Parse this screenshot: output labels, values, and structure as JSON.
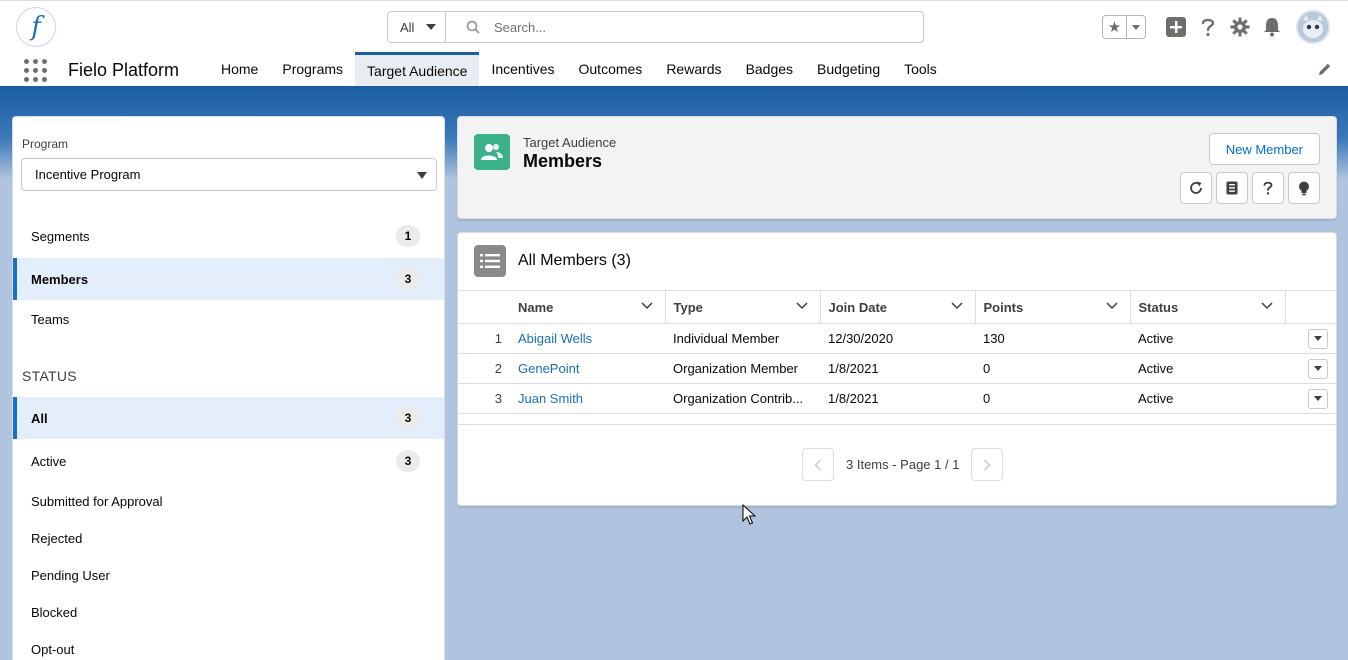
{
  "header": {
    "logo_letter": "f",
    "search_scope": "All",
    "search_placeholder": "Search..."
  },
  "nav": {
    "app_name": "Fielo Platform",
    "tabs": [
      {
        "label": "Home"
      },
      {
        "label": "Programs"
      },
      {
        "label": "Target Audience"
      },
      {
        "label": "Incentives"
      },
      {
        "label": "Outcomes"
      },
      {
        "label": "Rewards"
      },
      {
        "label": "Badges"
      },
      {
        "label": "Budgeting"
      },
      {
        "label": "Tools"
      }
    ],
    "active_tab": "Target Audience"
  },
  "sidebar": {
    "program_label": "Program",
    "program_value": "Incentive Program",
    "items": [
      {
        "label": "Segments",
        "count": "1"
      },
      {
        "label": "Members",
        "count": "3"
      },
      {
        "label": "Teams",
        "count": ""
      }
    ],
    "status_heading": "STATUS",
    "status_items": [
      {
        "label": "All",
        "count": "3"
      },
      {
        "label": "Active",
        "count": "3"
      },
      {
        "label": "Submitted for Approval",
        "count": ""
      },
      {
        "label": "Rejected",
        "count": ""
      },
      {
        "label": "Pending User",
        "count": ""
      },
      {
        "label": "Blocked",
        "count": ""
      },
      {
        "label": "Opt-out",
        "count": ""
      }
    ]
  },
  "page_header": {
    "subtitle": "Target Audience",
    "title": "Members",
    "new_button": "New Member"
  },
  "list": {
    "title": "All Members (3)",
    "columns": [
      "Name",
      "Type",
      "Join Date",
      "Points",
      "Status"
    ],
    "rows": [
      {
        "num": "1",
        "name": "Abigail Wells",
        "type": "Individual Member",
        "join_date": "12/30/2020",
        "points": "130",
        "status": "Active"
      },
      {
        "num": "2",
        "name": "GenePoint",
        "type": "Organization Member",
        "join_date": "1/8/2021",
        "points": "0",
        "status": "Active"
      },
      {
        "num": "3",
        "name": "Juan Smith",
        "type": "Organization Contrib...",
        "join_date": "1/8/2021",
        "points": "0",
        "status": "Active"
      }
    ],
    "pager_text": "3 Items - Page 1 / 1"
  },
  "colors": {
    "brand_blue": "#1b5f9e",
    "link": "#1b6fb5",
    "object_icon": "#3cb08b"
  }
}
